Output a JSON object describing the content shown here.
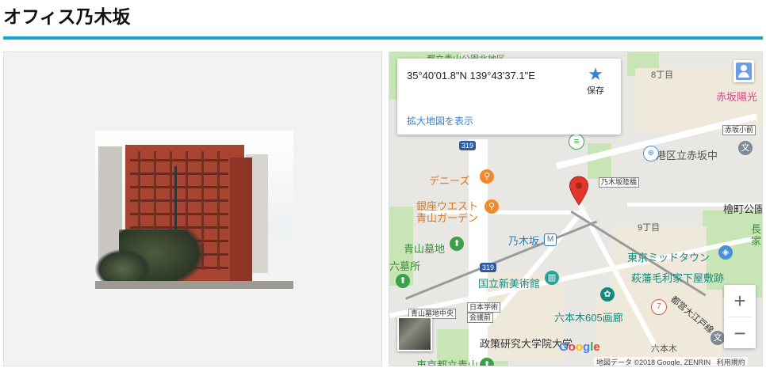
{
  "page": {
    "title": "オフィス乃木坂"
  },
  "photo": {
    "alt": "building-photo"
  },
  "map": {
    "coordinates": "35°40'01.8\"N 139°43'37.1\"E",
    "save_label": "保存",
    "larger_map_link": "拡大地図を表示",
    "zoom_in": "+",
    "zoom_out": "−",
    "logo_letters": [
      "G",
      "o",
      "o",
      "g",
      "l",
      "e"
    ],
    "attribution": "地図データ ©2018 Google, ZENRIN",
    "terms": "利用規約",
    "labels": {
      "denny": "デニーズ",
      "ginza_west_1": "銀座ウエスト",
      "ginza_west_2": "青山ガーデン",
      "aoyama_cemetery": "青山墓地",
      "rokubosho": "六墓所",
      "nogizaka": "乃木坂",
      "national_art": "国立新美術館",
      "tokyo_midtown": "東京ミッドタウン",
      "hagi_mansion": "萩藩毛利家下屋敷跡",
      "roppongi_605": "六本木605画廊",
      "grips": "政策研究大学院大学",
      "tokyo_aoyama": "東京都立青山",
      "minato_akasaka": "港区立赤坂中",
      "akasaka_yoko": "赤坂陽光",
      "hinoki": "檜町公園",
      "cho": "長",
      "ie": "家",
      "chome8": "8丁目",
      "chome9": "9丁目",
      "roppongi": "六本木",
      "toei_oedo": "都営大江戸線",
      "top_label": "都立青山公園北地区",
      "nogizaka_bridge": "乃木坂陸橋",
      "akasaka_komae": "赤坂小前",
      "aoyama_cemetery_center": "青山墓地中央",
      "nihon_gakujutsu_1": "日本学術",
      "nihon_gakujutsu_2": "会議前",
      "route_319a": "319",
      "route_319b": "319"
    }
  },
  "colors": {
    "accent": "#12a9d9",
    "pin": "#e0372c",
    "link": "#3b7fc4"
  }
}
